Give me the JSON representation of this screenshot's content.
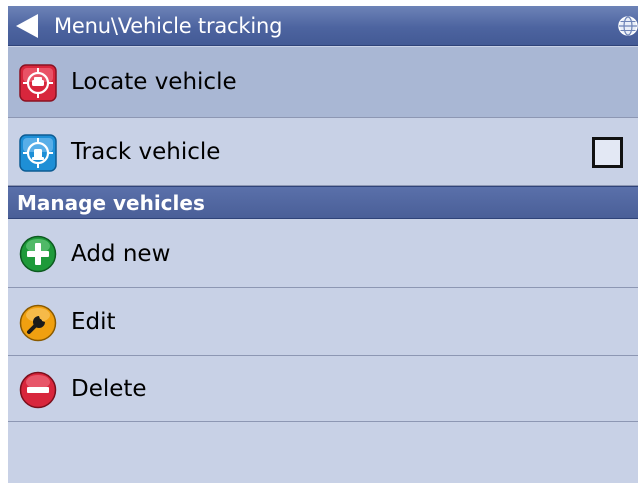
{
  "title_bar": {
    "title": "Menu\\Vehicle tracking",
    "back_icon": "back-arrow-icon",
    "globe_icon": "globe-icon"
  },
  "rows": {
    "locate": {
      "label": "Locate vehicle",
      "icon": "locate-vehicle-icon",
      "icon_color": "#d8263c"
    },
    "track": {
      "label": "Track vehicle",
      "icon": "track-vehicle-icon",
      "icon_color": "#1e8fd6",
      "checked": false
    }
  },
  "section": {
    "title": "Manage vehicles"
  },
  "manage_items": {
    "add": {
      "label": "Add new",
      "icon": "plus-icon",
      "icon_color": "#1e9a3a"
    },
    "edit": {
      "label": "Edit",
      "icon": "wrench-icon",
      "icon_color": "#f0a010"
    },
    "delete": {
      "label": "Delete",
      "icon": "minus-icon",
      "icon_color": "#d8263c"
    }
  },
  "colors": {
    "title_bar": "#4d64a0",
    "row_background": "#c8d1e6",
    "row_highlight": "#a9b7d4",
    "section_header": "#4a5f98"
  }
}
